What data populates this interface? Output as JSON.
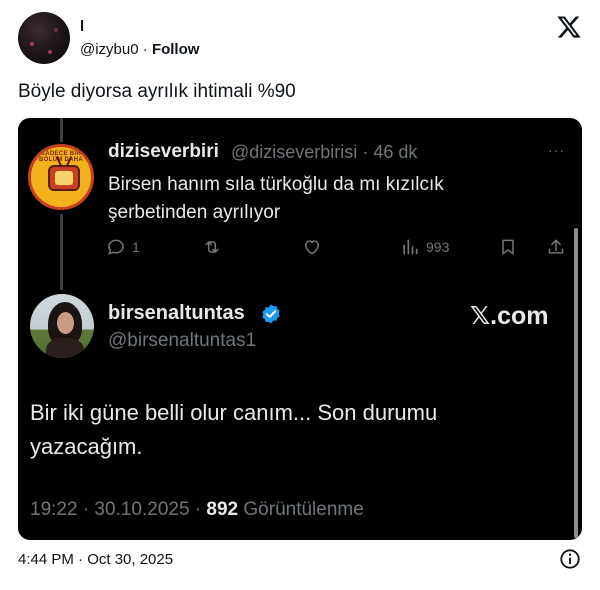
{
  "author": {
    "name": "l",
    "handle": "@izybu0",
    "separator": " · ",
    "follow_label": "Follow"
  },
  "brand_icon": "x-logo-icon",
  "tweet": {
    "text": "Böyle diyorsa ayrılık ihtimali %90",
    "timestamp": "4:44 PM · Oct 30, 2025"
  },
  "embed": {
    "quoted": {
      "name": "diziseverbiri",
      "handle": "@diziseverbirisi",
      "time": "· 46 dk",
      "more": "···",
      "text": "Birsen hanım sıla türkoğlu da mı kızılcık şerbetinden ayrılıyor",
      "logo_text": "SADECE BİR BÖLÜM DAHA",
      "actions": {
        "reply_count": "1",
        "repost_count": "",
        "like_count": "",
        "views_count": "993"
      }
    },
    "reply": {
      "name": "birsenaltuntas",
      "handle": "@birsenaltuntas1",
      "text": "Bir iki güne belli olur canım... Son durumu yazacağım.",
      "time": "19:22 · 30.10.2025 · ",
      "views": "892",
      "views_label": " Görüntülenme",
      "watermark": "𝕏.com"
    }
  },
  "colors": {
    "card_bg": "#000000",
    "text_light": "#e7e9ea",
    "text_muted": "#71767b",
    "verified_blue": "#1d9bf0",
    "logo_yellow": "#f2b21d",
    "logo_red": "#c7401f"
  }
}
